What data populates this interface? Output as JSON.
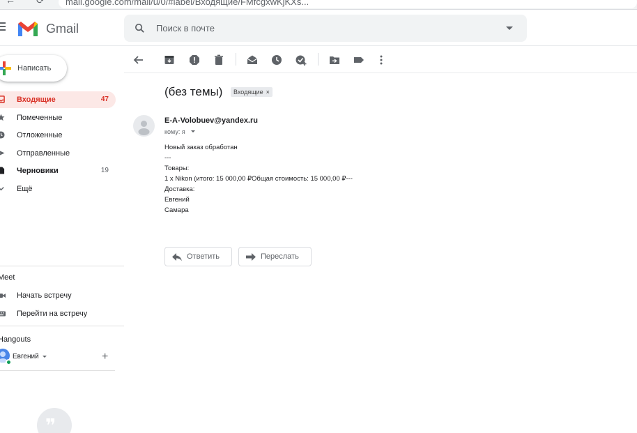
{
  "browser": {
    "url": "mail.google.com/mail/u/0/#label/Входящие/FMfcgxwKjKXs...",
    "back": "←",
    "reload": "⟳"
  },
  "header": {
    "app_name": "Gmail",
    "search_placeholder": "Поиск в почте"
  },
  "sidebar": {
    "compose_label": "Написать",
    "items": [
      {
        "label": "Входящие",
        "count": "47",
        "icon": "inbox-icon",
        "active": true
      },
      {
        "label": "Помеченные",
        "count": "",
        "icon": "star-icon"
      },
      {
        "label": "Отложенные",
        "count": "",
        "icon": "clock-icon"
      },
      {
        "label": "Отправленные",
        "count": "",
        "icon": "send-icon"
      },
      {
        "label": "Черновики",
        "count": "19",
        "icon": "draft-icon",
        "bold": true
      },
      {
        "label": "Ещё",
        "count": "",
        "icon": "chevron-down-icon"
      }
    ],
    "meet": {
      "title": "Meet",
      "start": "Начать встречу",
      "join": "Перейти на встречу"
    },
    "hangouts": {
      "title": "Hangouts",
      "user": "Евгений"
    }
  },
  "toolbar": {
    "icons": [
      "back-arrow-icon",
      "archive-icon",
      "report-spam-icon",
      "delete-icon",
      "mark-unread-icon",
      "snooze-icon",
      "add-to-tasks-icon",
      "move-to-icon",
      "label-icon",
      "more-icon"
    ]
  },
  "message": {
    "subject": "(без темы)",
    "label_chip": "Входящие",
    "label_chip_close": "×",
    "sender": "E-A-Volobuev@yandex.ru",
    "to_line": "кому: я",
    "body": [
      "Новый заказ обработан",
      "---",
      "Товары:",
      "1 x Nikon (итого: 15 000,00 ₽Общая стоимость: 15 000,00 ₽---",
      "Доставка:",
      "Евгений",
      "Самара"
    ],
    "reply_label": "Ответить",
    "forward_label": "Переслать"
  },
  "colors": {
    "accent_red": "#d93025",
    "active_bg": "#fce8e6",
    "search_bg": "#f1f3f4"
  }
}
